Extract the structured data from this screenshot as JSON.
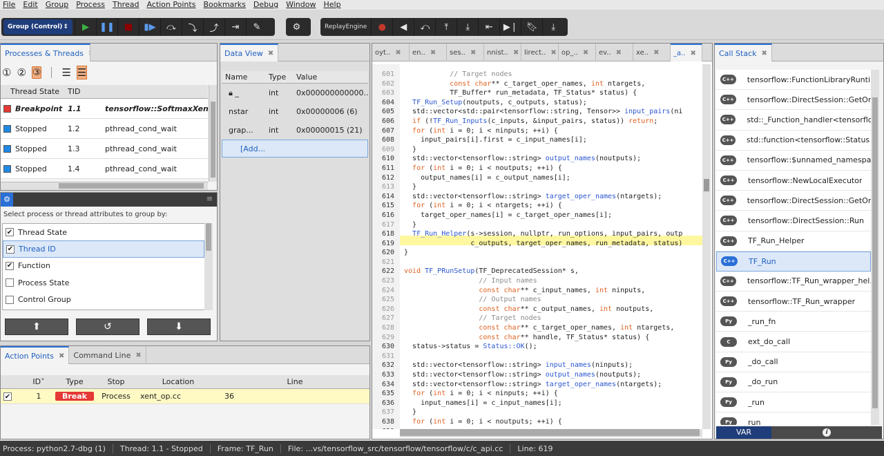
{
  "menu": [
    "File",
    "Edit",
    "Group",
    "Process",
    "Thread",
    "Action Points",
    "Bookmarks",
    "Debug",
    "Window",
    "Help"
  ],
  "toolbar": {
    "group_select": "Group (Control)",
    "replay_label": "ReplayEngine",
    "colors": {
      "go": "#3cb043",
      "halt": "#8b0000",
      "record": "#c0392b"
    }
  },
  "processes": {
    "tab_label": "Processes & Threads",
    "columns": [
      "Thread State",
      "TID",
      ""
    ],
    "rows": [
      {
        "state": "Breakpoint",
        "tid": "1.1",
        "func": "tensorflow::SoftmaxXentWith",
        "color": "#e53935"
      },
      {
        "state": "Stopped",
        "tid": "1.2",
        "func": "pthread_cond_wait",
        "color": "#1e88e5"
      },
      {
        "state": "Stopped",
        "tid": "1.3",
        "func": "pthread_cond_wait",
        "color": "#1e88e5"
      },
      {
        "state": "Stopped",
        "tid": "1.4",
        "func": "pthread_cond_wait",
        "color": "#1e88e5"
      }
    ]
  },
  "grouping": {
    "prompt": "Select process or thread attributes to group by:",
    "items": [
      {
        "label": "Thread State",
        "checked": true
      },
      {
        "label": "Thread ID",
        "checked": true
      },
      {
        "label": "Function",
        "checked": true
      },
      {
        "label": "Process State",
        "checked": false
      },
      {
        "label": "Control Group",
        "checked": false
      }
    ]
  },
  "data_view": {
    "tab_label": "Data View",
    "columns": [
      "Name",
      "Type",
      "Value"
    ],
    "rows": [
      {
        "name": "_",
        "type": "int",
        "value": "0x000000000000..."
      },
      {
        "name": "nstar",
        "type": "int",
        "value": "0x00000006 (6)"
      },
      {
        "name": "grap...",
        "type": "int",
        "value": "0x00000015 (21)"
      }
    ],
    "add_label": "[Add..."
  },
  "source_tabs": [
    "oyt..",
    "en..",
    "ses..",
    "nnist..",
    "lirect..",
    "op_..",
    "ev..",
    "xe..",
    "_a.."
  ],
  "source": {
    "lines": [
      [
        "601",
        "           // Target nodes"
      ],
      [
        "602",
        "           const char** c_target_oper_names, int ntargets,"
      ],
      [
        "603",
        "           TF_Buffer* run_metadata, TF_Status* status) {"
      ],
      [
        "604",
        "  TF_Run_Setup(noutputs, c_outputs, status);"
      ],
      [
        "605",
        "  std::vector<std::pair<tensorflow::string, Tensor>> input_pairs(ni"
      ],
      [
        "606",
        "  if (!TF_Run_Inputs(c_inputs, &input_pairs, status)) return;"
      ],
      [
        "607",
        "  for (int i = 0; i < ninputs; ++i) {"
      ],
      [
        "608",
        "    input_pairs[i].first = c_input_names[i];"
      ],
      [
        "609",
        "  }"
      ],
      [
        "610",
        "  std::vector<tensorflow::string> output_names(noutputs);"
      ],
      [
        "611",
        "  for (int i = 0; i < noutputs; ++i) {"
      ],
      [
        "612",
        "    output_names[i] = c_output_names[i];"
      ],
      [
        "613",
        "  }"
      ],
      [
        "614",
        "  std::vector<tensorflow::string> target_oper_names(ntargets);"
      ],
      [
        "615",
        "  for (int i = 0; i < ntargets; ++i) {"
      ],
      [
        "616",
        "    target_oper_names[i] = c_target_oper_names[i];"
      ],
      [
        "617",
        "  }"
      ],
      [
        "618",
        "  TF_Run_Helper(s->session, nullptr, run_options, input_pairs, outp"
      ],
      [
        "619",
        "                c_outputs, target_oper_names, run_metadata, status)"
      ],
      [
        "620",
        "}"
      ],
      [
        "621",
        ""
      ],
      [
        "622",
        "void TF_PRunSetup(TF_DeprecatedSession* s,"
      ],
      [
        "623",
        "                  // Input names"
      ],
      [
        "624",
        "                  const char** c_input_names, int ninputs,"
      ],
      [
        "625",
        "                  // Output names"
      ],
      [
        "626",
        "                  const char** c_output_names, int noutputs,"
      ],
      [
        "627",
        "                  // Target nodes"
      ],
      [
        "628",
        "                  const char** c_target_oper_names, int ntargets,"
      ],
      [
        "629",
        "                  const char** handle, TF_Status* status) {"
      ],
      [
        "630",
        "  status->status = Status::OK();"
      ],
      [
        "631",
        ""
      ],
      [
        "632",
        "  std::vector<tensorflow::string> input_names(ninputs);"
      ],
      [
        "633",
        "  std::vector<tensorflow::string> output_names(noutputs);"
      ],
      [
        "634",
        "  std::vector<tensorflow::string> target_oper_names(ntargets);"
      ],
      [
        "635",
        "  for (int i = 0; i < ninputs; ++i) {"
      ],
      [
        "636",
        "    input_names[i] = c_input_names[i];"
      ],
      [
        "637",
        "  }"
      ],
      [
        "638",
        "  for (int i = 0; i < noutputs; ++i) {"
      ],
      [
        "639",
        ""
      ]
    ]
  },
  "call_stack": {
    "tab_label": "Call Stack",
    "frames": [
      {
        "lang": "C++",
        "name": "tensorflow::FunctionLibraryRunti..."
      },
      {
        "lang": "C++",
        "name": "tensorflow::DirectSession::GetOr..."
      },
      {
        "lang": "C++",
        "name": "std::_Function_handler<tensorflo..."
      },
      {
        "lang": "C++",
        "name": "std::function<tensorflow::Status (..."
      },
      {
        "lang": "C++",
        "name": "tensorflow::$unnamed_namespa..."
      },
      {
        "lang": "C++",
        "name": "tensorflow::NewLocalExecutor"
      },
      {
        "lang": "C++",
        "name": "tensorflow::DirectSession::GetOr..."
      },
      {
        "lang": "C++",
        "name": "tensorflow::DirectSession::Run"
      },
      {
        "lang": "C++",
        "name": "TF_Run_Helper"
      },
      {
        "lang": "C++",
        "name": "TF_Run"
      },
      {
        "lang": "C++",
        "name": "tensorflow::TF_Run_wrapper_hel..."
      },
      {
        "lang": "C++",
        "name": "tensorflow::TF_Run_wrapper"
      },
      {
        "lang": "Py",
        "name": "_run_fn"
      },
      {
        "lang": "C",
        "name": "ext_do_call"
      },
      {
        "lang": "Py",
        "name": "_do_call"
      },
      {
        "lang": "Py",
        "name": "_do_run"
      },
      {
        "lang": "Py",
        "name": "_run"
      },
      {
        "lang": "Py",
        "name": "run"
      }
    ],
    "footer_var": "VAR",
    "footer_info": "i"
  },
  "action_points": {
    "tab_label": "Action Points",
    "tab2_label": "Command Line",
    "columns": [
      "ID",
      "Type",
      "Stop",
      "Location",
      "Line"
    ],
    "rows": [
      {
        "id": "1",
        "type": "Break",
        "stop": "Process",
        "location": "xent_op.cc",
        "line": "36"
      }
    ]
  },
  "status": {
    "process": "Process: python2.7-dbg (1)",
    "thread": "Thread: 1.1 - Stopped",
    "frame": "Frame: TF_Run",
    "file": "File: ...vs/tensorflow_src/tensorflow/tensorflow/c/c_api.cc",
    "line": "Line: 619"
  }
}
